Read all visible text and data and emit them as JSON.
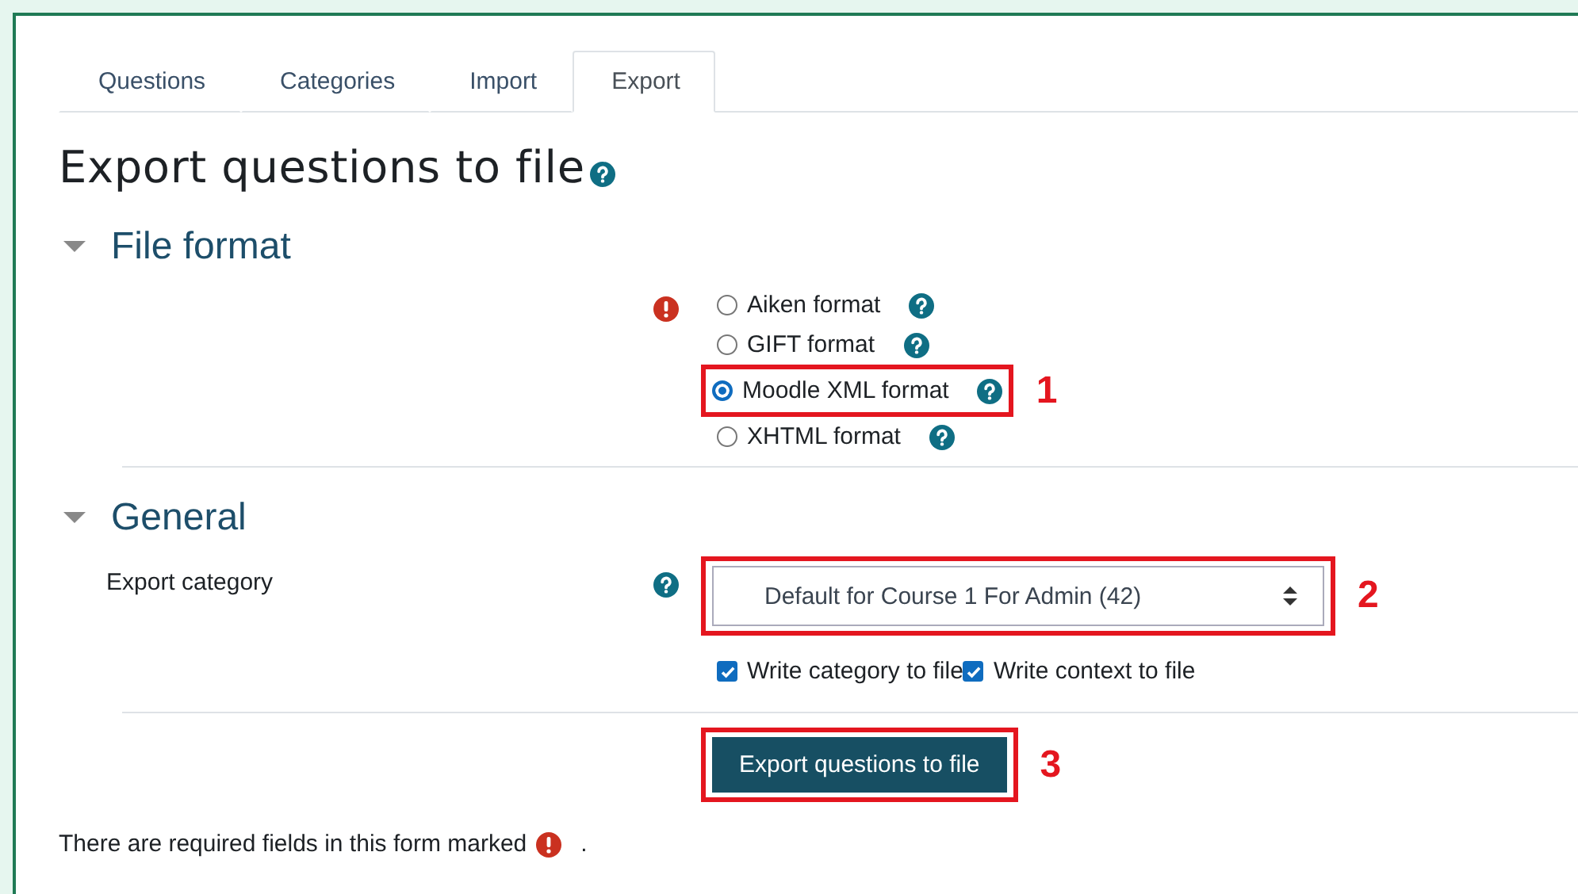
{
  "tabs": [
    {
      "label": "Questions",
      "selected": false
    },
    {
      "label": "Categories",
      "selected": false
    },
    {
      "label": "Import",
      "selected": false
    },
    {
      "label": "Export",
      "selected": true
    }
  ],
  "title": "Export questions to file",
  "file_format": {
    "heading": "File format",
    "expanded": true,
    "required": true,
    "options": [
      {
        "label": "Aiken format",
        "selected": false
      },
      {
        "label": "GIFT format",
        "selected": false
      },
      {
        "label": "Moodle XML format",
        "selected": true,
        "annotation": "1"
      },
      {
        "label": "XHTML format",
        "selected": false
      }
    ]
  },
  "general": {
    "heading": "General",
    "expanded": true,
    "export_category": {
      "label": "Export category",
      "value": "Default for Course 1 For Admin (42)",
      "annotation": "2"
    },
    "checkboxes": [
      {
        "label": "Write category to file",
        "checked": true
      },
      {
        "label": "Write context to file",
        "checked": true
      }
    ]
  },
  "submit": {
    "label": "Export questions to file",
    "annotation": "3"
  },
  "footer": {
    "text": "There are required fields in this form marked",
    "suffix": "."
  }
}
